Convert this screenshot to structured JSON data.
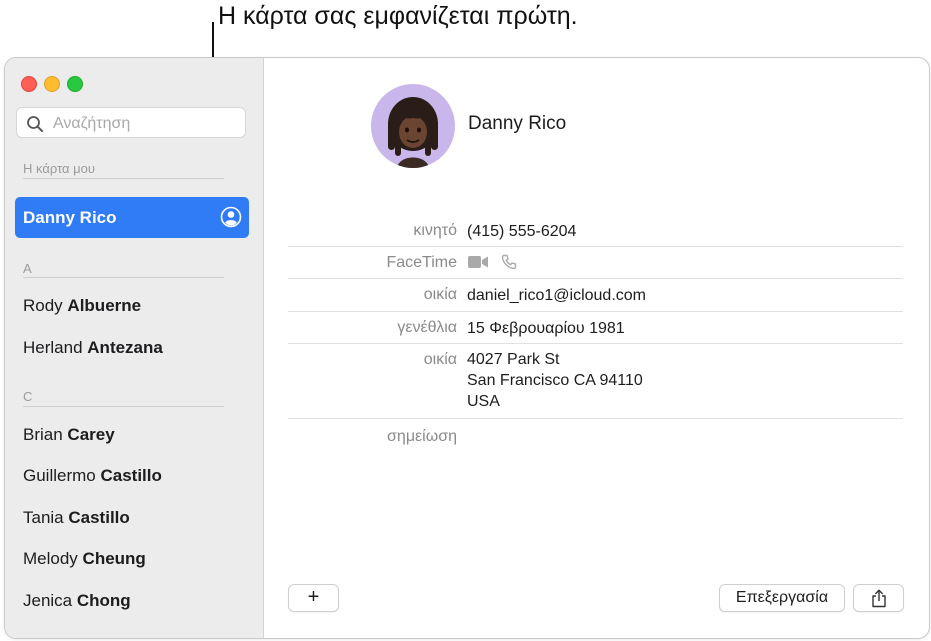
{
  "callout": {
    "text": "Η κάρτα σας εμφανίζεται πρώτη."
  },
  "sidebar": {
    "search_placeholder": "Αναζήτηση",
    "my_card_header": "Η κάρτα μου",
    "my_card_name": "Danny Rico",
    "groups": [
      {
        "letter": "A",
        "contacts": [
          {
            "first": "Rody",
            "last": "Albuerne"
          },
          {
            "first": "Herland",
            "last": "Antezana"
          }
        ]
      },
      {
        "letter": "C",
        "contacts": [
          {
            "first": "Brian",
            "last": "Carey"
          },
          {
            "first": "Guillermo",
            "last": "Castillo"
          },
          {
            "first": "Tania",
            "last": "Castillo"
          },
          {
            "first": "Melody",
            "last": "Cheung"
          },
          {
            "first": "Jenica",
            "last": "Chong"
          }
        ]
      }
    ]
  },
  "card": {
    "name": "Danny Rico",
    "fields": {
      "mobile": {
        "label": "κινητό",
        "value": "(415) 555-6204"
      },
      "facetime": {
        "label": "FaceTime",
        "icons": [
          "video-camera-icon",
          "phone-icon"
        ]
      },
      "email": {
        "label": "οικία",
        "value": "daniel_rico1@icloud.com"
      },
      "birthday": {
        "label": "γενέθλια",
        "value": "15 Φεβρουαρίου 1981"
      },
      "address": {
        "label": "οικία",
        "lines": [
          "4027 Park St",
          "San Francisco CA 94110",
          "USA"
        ]
      },
      "note": {
        "label": "σημείωση",
        "value": ""
      }
    }
  },
  "toolbar": {
    "add_label": "+",
    "edit_label": "Επεξεργασία",
    "share_icon": "share-icon"
  },
  "colors": {
    "selection": "#2f7cf6",
    "sidebar_bg": "#ececec",
    "avatar_bg": "#c9b6ea"
  }
}
